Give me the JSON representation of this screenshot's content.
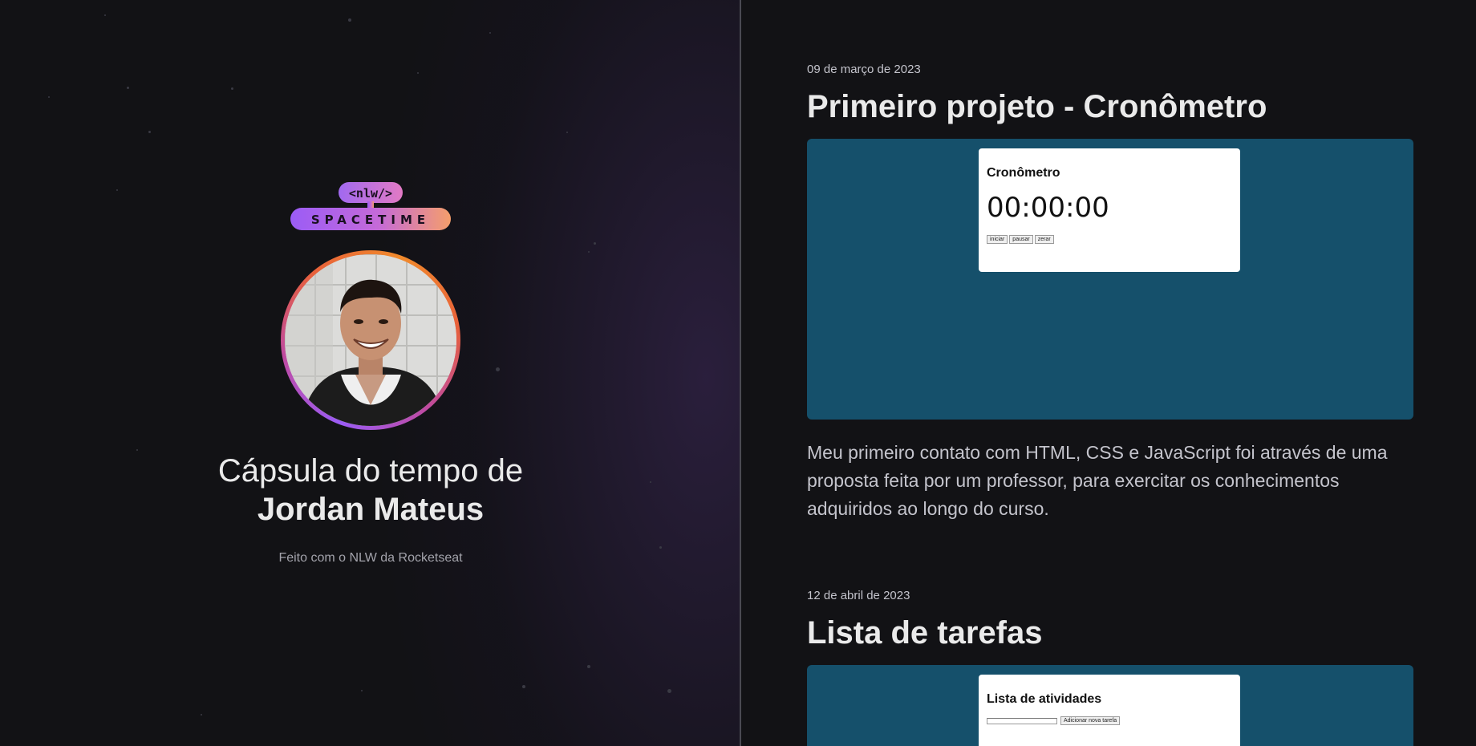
{
  "profile": {
    "logo_top": "<nlw/>",
    "logo_bottom": "SPACETIME",
    "title_line1": "Cápsula do tempo de",
    "title_name": "Jordan Mateus",
    "made_with": "Feito com o NLW da Rocketseat"
  },
  "colors": {
    "background": "#121215",
    "preview_bg": "#15506b",
    "logo_gradient_start": "#9b5cf6",
    "logo_gradient_end": "#f59e6b",
    "ring_orange": "#f08a2c",
    "ring_purple": "#9b5cf6"
  },
  "entries": [
    {
      "date": "09 de março de 2023",
      "title": "Primeiro projeto - Cronômetro",
      "preview": {
        "card_title": "Cronômetro",
        "time": "00:00:00",
        "buttons": [
          "iniciar",
          "pausar",
          "zerar"
        ]
      },
      "description": "Meu primeiro contato com HTML, CSS e JavaScript foi através de uma proposta feita por um professor, para exercitar os conhecimentos adquiridos ao longo do curso."
    },
    {
      "date": "12 de abril de 2023",
      "title": "Lista de tarefas",
      "preview": {
        "card_title": "Lista de atividades",
        "button": "Adicionar nova tarefa"
      }
    }
  ]
}
